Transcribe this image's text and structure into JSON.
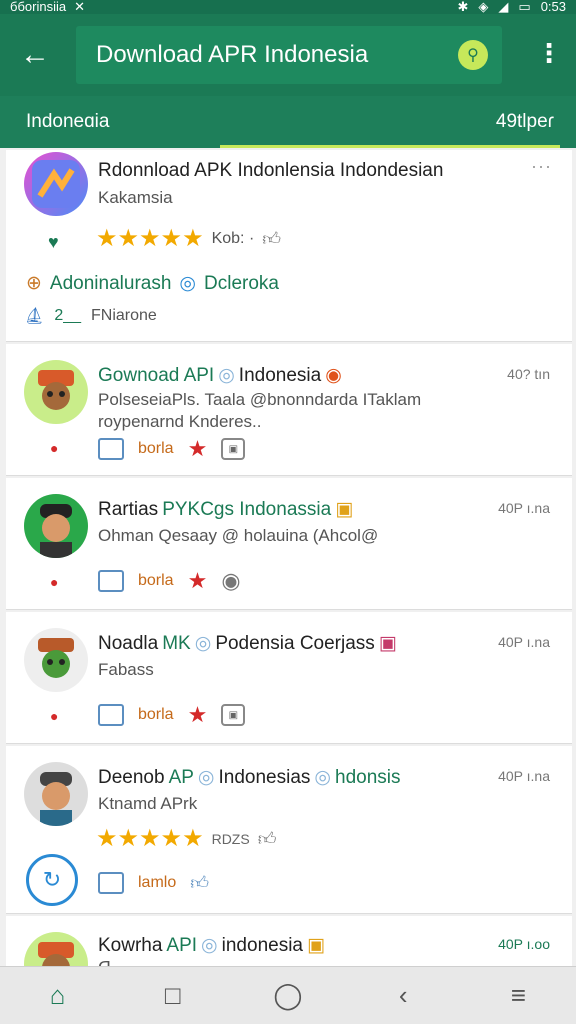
{
  "status": {
    "left": "ббоrinsiia",
    "right": "0:53"
  },
  "header": {
    "search_text": "Download APR Indonesia"
  },
  "subbar": {
    "left": "Indoneɑia",
    "right": "49tlpeɾ"
  },
  "cards": [
    {
      "title": "Rdonnload APK Indonlensia Indondesian",
      "subtitle": "Kakamsia",
      "rating_text": "Kob: ·",
      "tag1": "Adoninalurash",
      "tag2": "Dcleroka",
      "extra_count": "2__",
      "extra_text": "FNiarone"
    },
    {
      "title": "Gownoad API",
      "title2": "Indonesia",
      "size": "40? tın",
      "desc1": "PolseseiaPls. Taala @bnonndarda ITaklam",
      "desc2": "roypenarnd Knderes..",
      "tag": "borla"
    },
    {
      "title": "Rartias",
      "title2": "PYKCgs Indonassia",
      "size": "40P ı.na",
      "desc1": "Ohman Qesaay @ holauina (Ahcol@",
      "tag": "borla"
    },
    {
      "title": "Noadla",
      "title2": "MK",
      "title3": "Podensia Coerjass",
      "size": "40P ı.na",
      "desc1": "Fabass",
      "tag": "borla"
    },
    {
      "title": "Deenob",
      "title2": "AP",
      "title3": "Indonesias",
      "title4": "hdonsis",
      "size": "40P ı.na",
      "desc1": "Ktnamd APrk",
      "rating_text": "RDZS",
      "tag": "lamlo"
    },
    {
      "title": "Kowrha",
      "title2": "API",
      "title3": "indonesia",
      "size": "40P ı.oo",
      "desc1": "ᗡ"
    }
  ]
}
